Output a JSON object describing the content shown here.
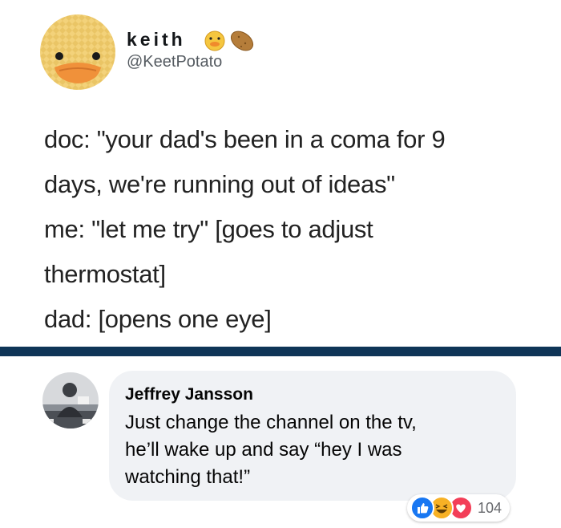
{
  "tweet": {
    "display_name": "keith",
    "handle": "@KeetPotato",
    "name_emojis": [
      "duck-face",
      "potato"
    ],
    "lines": [
      "doc: \"your dad's been in a coma for 9",
      "days, we're running out of ideas\"",
      "me: \"let me try\" [goes to adjust",
      "thermostat]",
      "dad: [opens one eye]"
    ]
  },
  "comment": {
    "author": "Jeffrey Jansson",
    "lines": [
      "Just change the channel on the tv,",
      "he’ll wake up and say “hey I was",
      "watching that!”"
    ],
    "reactions": [
      "like",
      "haha",
      "love"
    ],
    "reaction_count": "104"
  },
  "colors": {
    "divider": "#0f3557",
    "bubble": "#f0f2f5",
    "like": "#1877f2",
    "haha": "#f7b125",
    "love": "#f33e58"
  }
}
